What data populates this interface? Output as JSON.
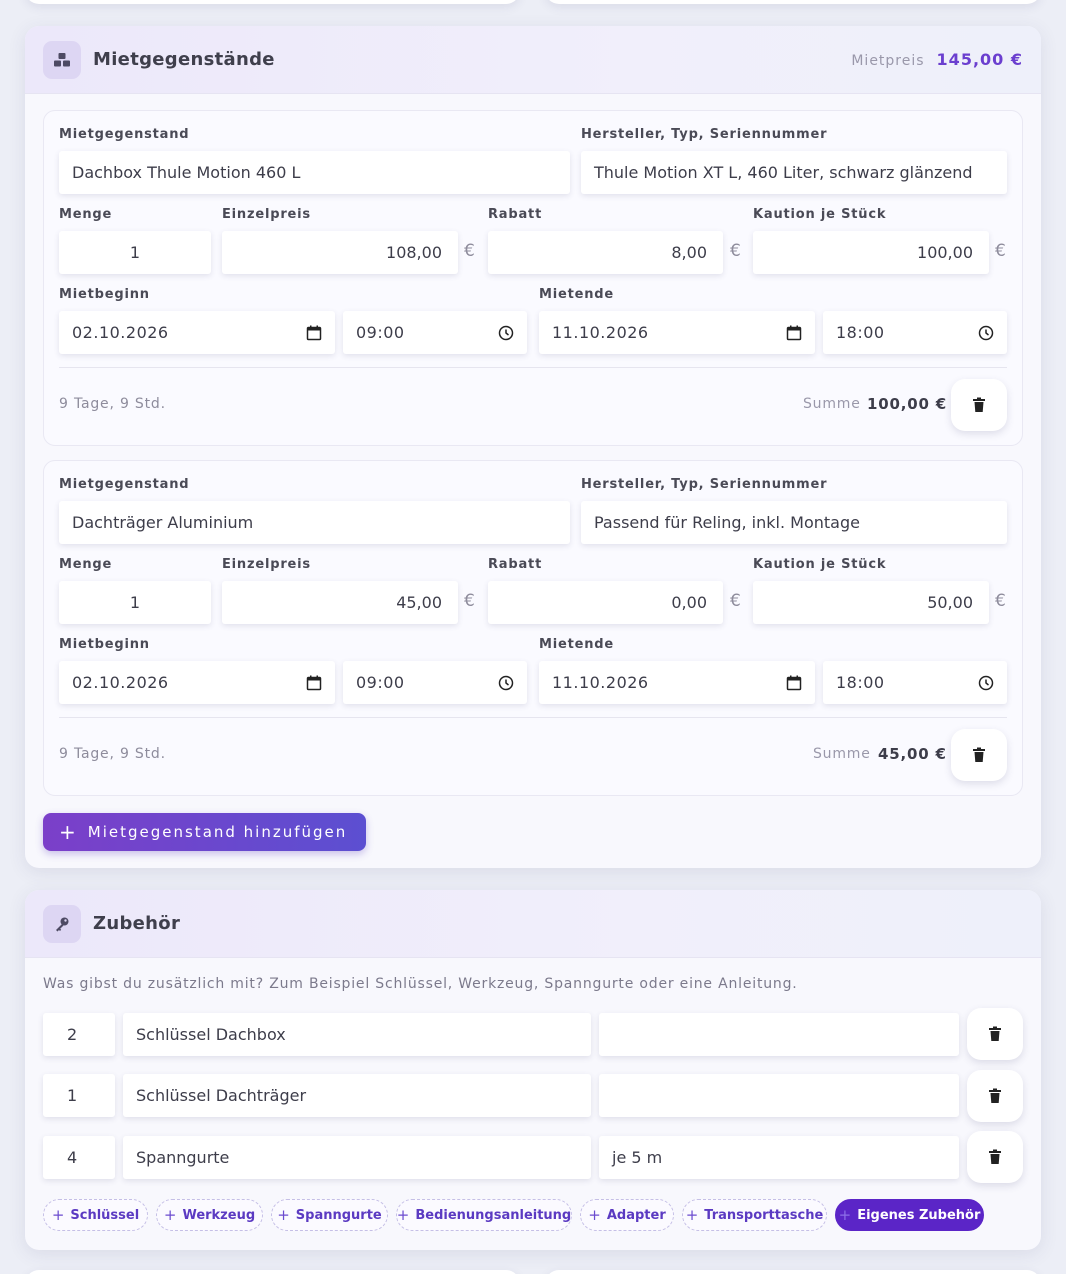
{
  "rental_items_section": {
    "title": "Mietgegenstände",
    "price_label": "Mietpreis",
    "price_value": "145,00 €",
    "labels": {
      "item": "Mietgegenstand",
      "manufacturer": "Hersteller, Typ, Seriennummer",
      "quantity": "Menge",
      "unit_price": "Einzelpreis",
      "discount": "Rabatt",
      "deposit": "Kaution je Stück",
      "start": "Mietbeginn",
      "end": "Mietende",
      "sum": "Summe",
      "currency": "€"
    },
    "items": [
      {
        "name": "Dachbox Thule Motion 460 L",
        "manufacturer": "Thule Motion XT L, 460 Liter, schwarz glänzend",
        "quantity": "1",
        "unit_price": "108,00",
        "discount": "8,00",
        "deposit": "100,00",
        "start_date": "02.10.2026",
        "start_time": "09:00",
        "end_date": "11.10.2026",
        "end_time": "18:00",
        "duration": "9 Tage, 9 Std.",
        "sum": "100,00 €"
      },
      {
        "name": "Dachträger Aluminium",
        "manufacturer": "Passend für Reling, inkl. Montage",
        "quantity": "1",
        "unit_price": "45,00",
        "discount": "0,00",
        "deposit": "50,00",
        "start_date": "02.10.2026",
        "start_time": "09:00",
        "end_date": "11.10.2026",
        "end_time": "18:00",
        "duration": "9 Tage, 9 Std.",
        "sum": "45,00 €"
      }
    ],
    "add_button_label": "Mietgegenstand hinzufügen"
  },
  "accessories_section": {
    "title": "Zubehör",
    "description": "Was gibst du zusätzlich mit? Zum Beispiel Schlüssel, Werkzeug, Spanngurte oder eine Anleitung.",
    "rows": [
      {
        "qty": "2",
        "name": "Schlüssel Dachbox",
        "note": ""
      },
      {
        "qty": "1",
        "name": "Schlüssel Dachträger",
        "note": ""
      },
      {
        "qty": "4",
        "name": "Spanngurte",
        "note": "je 5 m"
      }
    ],
    "chips": [
      "Schlüssel",
      "Werkzeug",
      "Spanngurte",
      "Bedienungsanleitung",
      "Adapter",
      "Transporttasche"
    ],
    "custom_chip": "Eigenes Zubehör"
  },
  "colors": {
    "accent": "#6b3fcf",
    "button_gradient_start": "#7b3fc9",
    "button_gradient_end": "#5c4fd1",
    "primary_chip": "#5b25c7"
  },
  "icons": [
    "boxes-icon",
    "key-icon",
    "trash-icon",
    "calendar-icon",
    "clock-icon",
    "plus-icon"
  ]
}
